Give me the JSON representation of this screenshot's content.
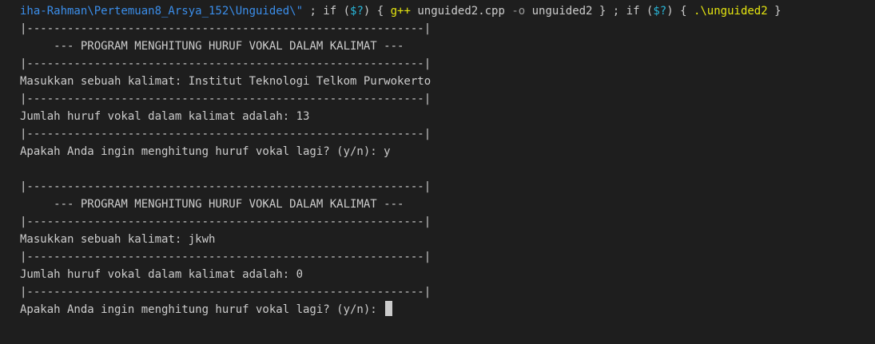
{
  "terminal": {
    "command": {
      "path": "iha-Rahman\\Pertemuan8_Arsya_152\\Unguided\\\"",
      "sep1": " ; if (",
      "var1": "$?",
      "close1": ") { ",
      "compiler": "g++",
      "source": " unguided2.cpp ",
      "flag": "-o",
      "output": " unguided2 } ; if (",
      "var2": "$?",
      "close2": ") { ",
      "exe": ".\\unguided2",
      "end": " }"
    },
    "lines": [
      "|-----------------------------------------------------------|",
      "     --- PROGRAM MENGHITUNG HURUF VOKAL DALAM KALIMAT ---",
      "|-----------------------------------------------------------|",
      "Masukkan sebuah kalimat: Institut Teknologi Telkom Purwokerto",
      "|-----------------------------------------------------------|",
      "Jumlah huruf vokal dalam kalimat adalah: 13",
      "|-----------------------------------------------------------|",
      "Apakah Anda ingin menghitung huruf vokal lagi? (y/n): y",
      "",
      "|-----------------------------------------------------------|",
      "     --- PROGRAM MENGHITUNG HURUF VOKAL DALAM KALIMAT ---",
      "|-----------------------------------------------------------|",
      "Masukkan sebuah kalimat: jkwh",
      "|-----------------------------------------------------------|",
      "Jumlah huruf vokal dalam kalimat adalah: 0",
      "|-----------------------------------------------------------|"
    ],
    "prompt": "Apakah Anda ingin menghitung huruf vokal lagi? (y/n): "
  }
}
